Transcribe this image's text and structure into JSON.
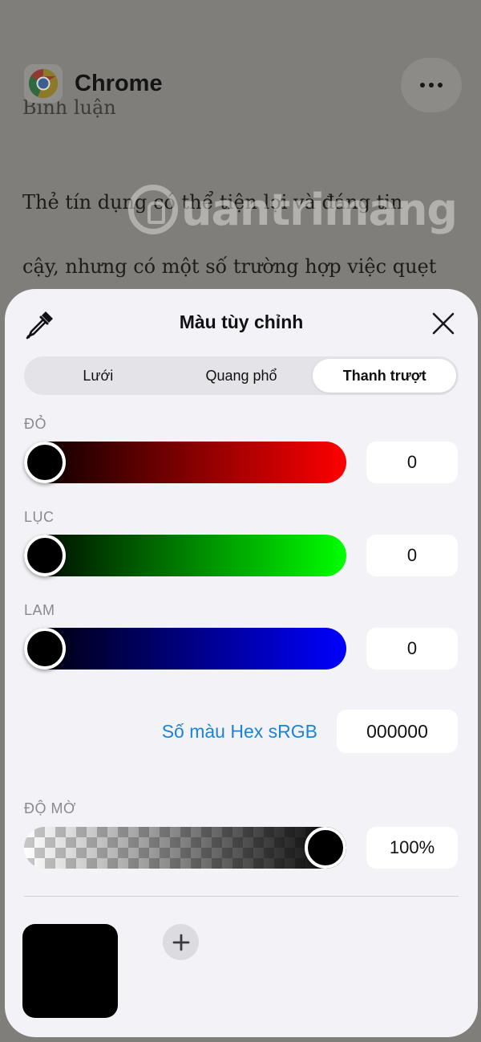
{
  "background": {
    "app_name": "Chrome",
    "lines": [
      "Bình luận",
      "Thẻ tín dụng có thể tiện lợi và đáng tin",
      "cậy, nhưng có một số trường hợp việc quẹt"
    ],
    "watermark": "uantrimang"
  },
  "picker": {
    "title": "Màu tùy chỉnh",
    "tabs": [
      "Lưới",
      "Quang phổ",
      "Thanh trượt"
    ],
    "active_tab": "Thanh trượt",
    "red": {
      "label": "ĐỎ",
      "value": "0"
    },
    "green": {
      "label": "LỤC",
      "value": "0"
    },
    "blue": {
      "label": "LAM",
      "value": "0"
    },
    "hex": {
      "label": "Số màu Hex sRGB",
      "value": "000000"
    },
    "opacity": {
      "label": "ĐỘ MỜ",
      "value": "100%",
      "level": 1.0
    },
    "selected_color": "#000000",
    "colors": {
      "accent": "#1c84d4",
      "sheet": "#f2f2f7"
    },
    "icons": [
      "eyedropper-icon",
      "close-icon",
      "plus-icon",
      "more-icon",
      "chrome-logo-icon"
    ]
  }
}
